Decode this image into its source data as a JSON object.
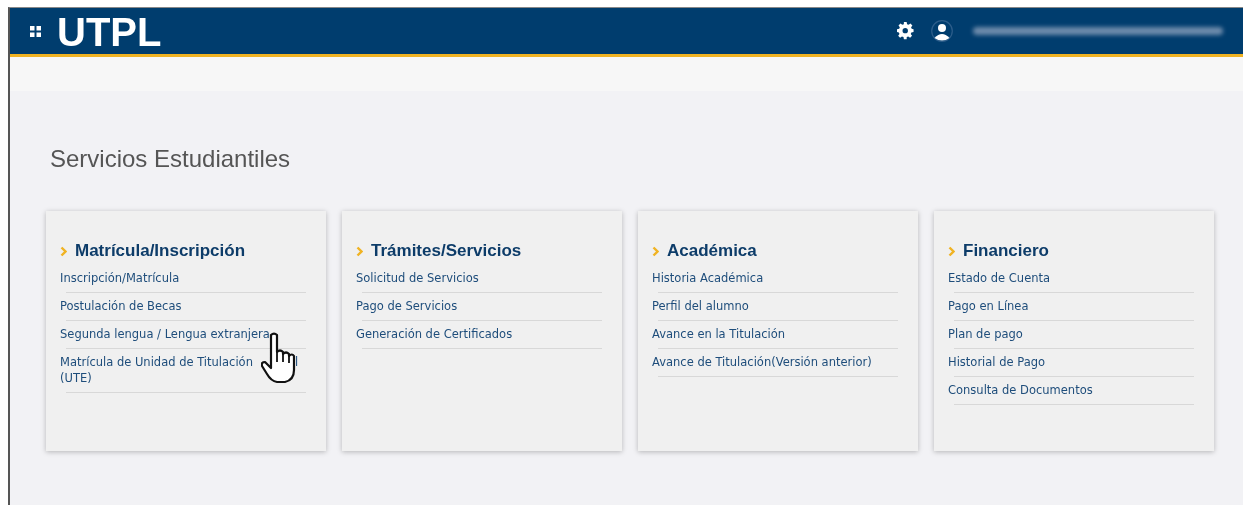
{
  "header": {
    "logo": "UTPL"
  },
  "page": {
    "title": "Servicios Estudiantiles"
  },
  "cards": [
    {
      "title": "Matrícula/Inscripción",
      "items": [
        {
          "label": "Inscripción/Matrícula"
        },
        {
          "label": "Postulación de Becas"
        },
        {
          "label": "Segunda lengua / Lengua extranjera"
        },
        {
          "label": "Matrícula de Unidad de Titulación",
          "label_after_cursor": "l",
          "label_line_2": "(UTE)"
        }
      ]
    },
    {
      "title": "Trámites/Servicios",
      "items": [
        {
          "label": "Solicitud de Servicios"
        },
        {
          "label": "Pago de Servicios"
        },
        {
          "label": "Generación de Certificados"
        }
      ]
    },
    {
      "title": "Académica",
      "items": [
        {
          "label": "Historia Académica"
        },
        {
          "label": "Perfil del alumno"
        },
        {
          "label": "Avance en la Titulación"
        },
        {
          "label": "Avance de Titulación(Versión anterior)"
        }
      ]
    },
    {
      "title": "Financiero",
      "items": [
        {
          "label": "Estado de Cuenta"
        },
        {
          "label": "Pago en Línea"
        },
        {
          "label": "Plan de pago"
        },
        {
          "label": "Historial de Pago"
        },
        {
          "label": "Consulta de Documentos"
        }
      ]
    }
  ]
}
